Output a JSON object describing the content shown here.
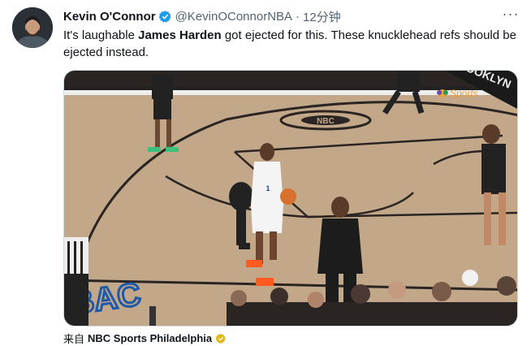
{
  "tweet": {
    "author_name": "Kevin O'Connor",
    "handle": "@KevinOConnorNBA",
    "separator": "·",
    "time": "12分钟",
    "more_icon": "ellipsis-icon",
    "text_before": "It's laughable ",
    "text_bold": "James Harden",
    "text_after": " got ejected for this. These knucklehead refs should be ejected instead."
  },
  "media": {
    "court_logo_text": "NBC",
    "corner_text": "BROOKLYN",
    "watermark": "Sports",
    "floor_text": "BAC",
    "player_number": "1"
  },
  "source": {
    "prefix": "来自",
    "name": "NBC Sports Philadelphia",
    "badge_color": "#e2b719"
  },
  "colors": {
    "verified": "#1d9bf0",
    "secondary_text": "#536471"
  }
}
